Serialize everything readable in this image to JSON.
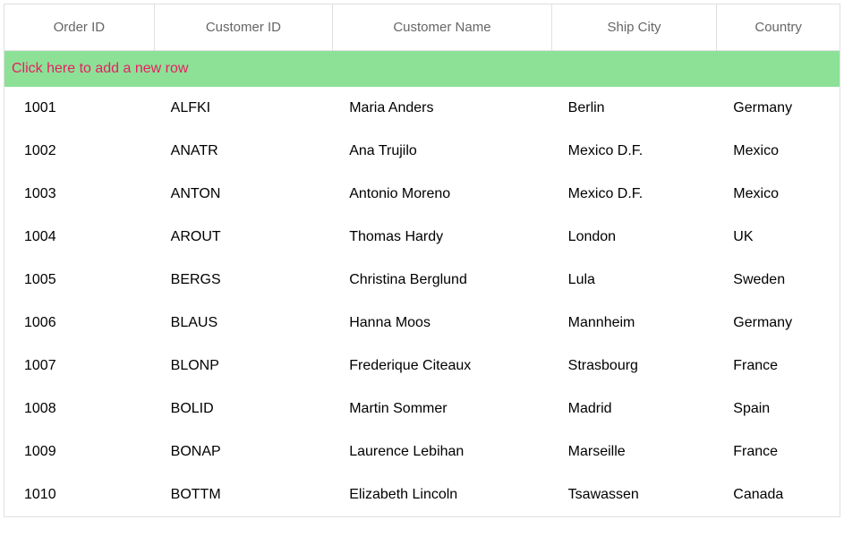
{
  "table": {
    "columns": [
      {
        "label": "Order ID"
      },
      {
        "label": "Customer ID"
      },
      {
        "label": "Customer Name"
      },
      {
        "label": "Ship City"
      },
      {
        "label": "Country"
      }
    ],
    "addRowText": "Click here to add a new row",
    "rows": [
      {
        "orderId": "1001",
        "customerId": "ALFKI",
        "customerName": "Maria Anders",
        "shipCity": "Berlin",
        "country": "Germany"
      },
      {
        "orderId": "1002",
        "customerId": "ANATR",
        "customerName": "Ana Trujilo",
        "shipCity": "Mexico D.F.",
        "country": "Mexico"
      },
      {
        "orderId": "1003",
        "customerId": "ANTON",
        "customerName": "Antonio Moreno",
        "shipCity": "Mexico D.F.",
        "country": "Mexico"
      },
      {
        "orderId": "1004",
        "customerId": "AROUT",
        "customerName": "Thomas Hardy",
        "shipCity": "London",
        "country": "UK"
      },
      {
        "orderId": "1005",
        "customerId": "BERGS",
        "customerName": "Christina Berglund",
        "shipCity": "Lula",
        "country": "Sweden"
      },
      {
        "orderId": "1006",
        "customerId": "BLAUS",
        "customerName": "Hanna Moos",
        "shipCity": "Mannheim",
        "country": "Germany"
      },
      {
        "orderId": "1007",
        "customerId": "BLONP",
        "customerName": "Frederique Citeaux",
        "shipCity": "Strasbourg",
        "country": "France"
      },
      {
        "orderId": "1008",
        "customerId": "BOLID",
        "customerName": "Martin Sommer",
        "shipCity": "Madrid",
        "country": "Spain"
      },
      {
        "orderId": "1009",
        "customerId": "BONAP",
        "customerName": "Laurence Lebihan",
        "shipCity": "Marseille",
        "country": "France"
      },
      {
        "orderId": "1010",
        "customerId": "BOTTM",
        "customerName": "Elizabeth Lincoln",
        "shipCity": "Tsawassen",
        "country": "Canada"
      }
    ]
  }
}
